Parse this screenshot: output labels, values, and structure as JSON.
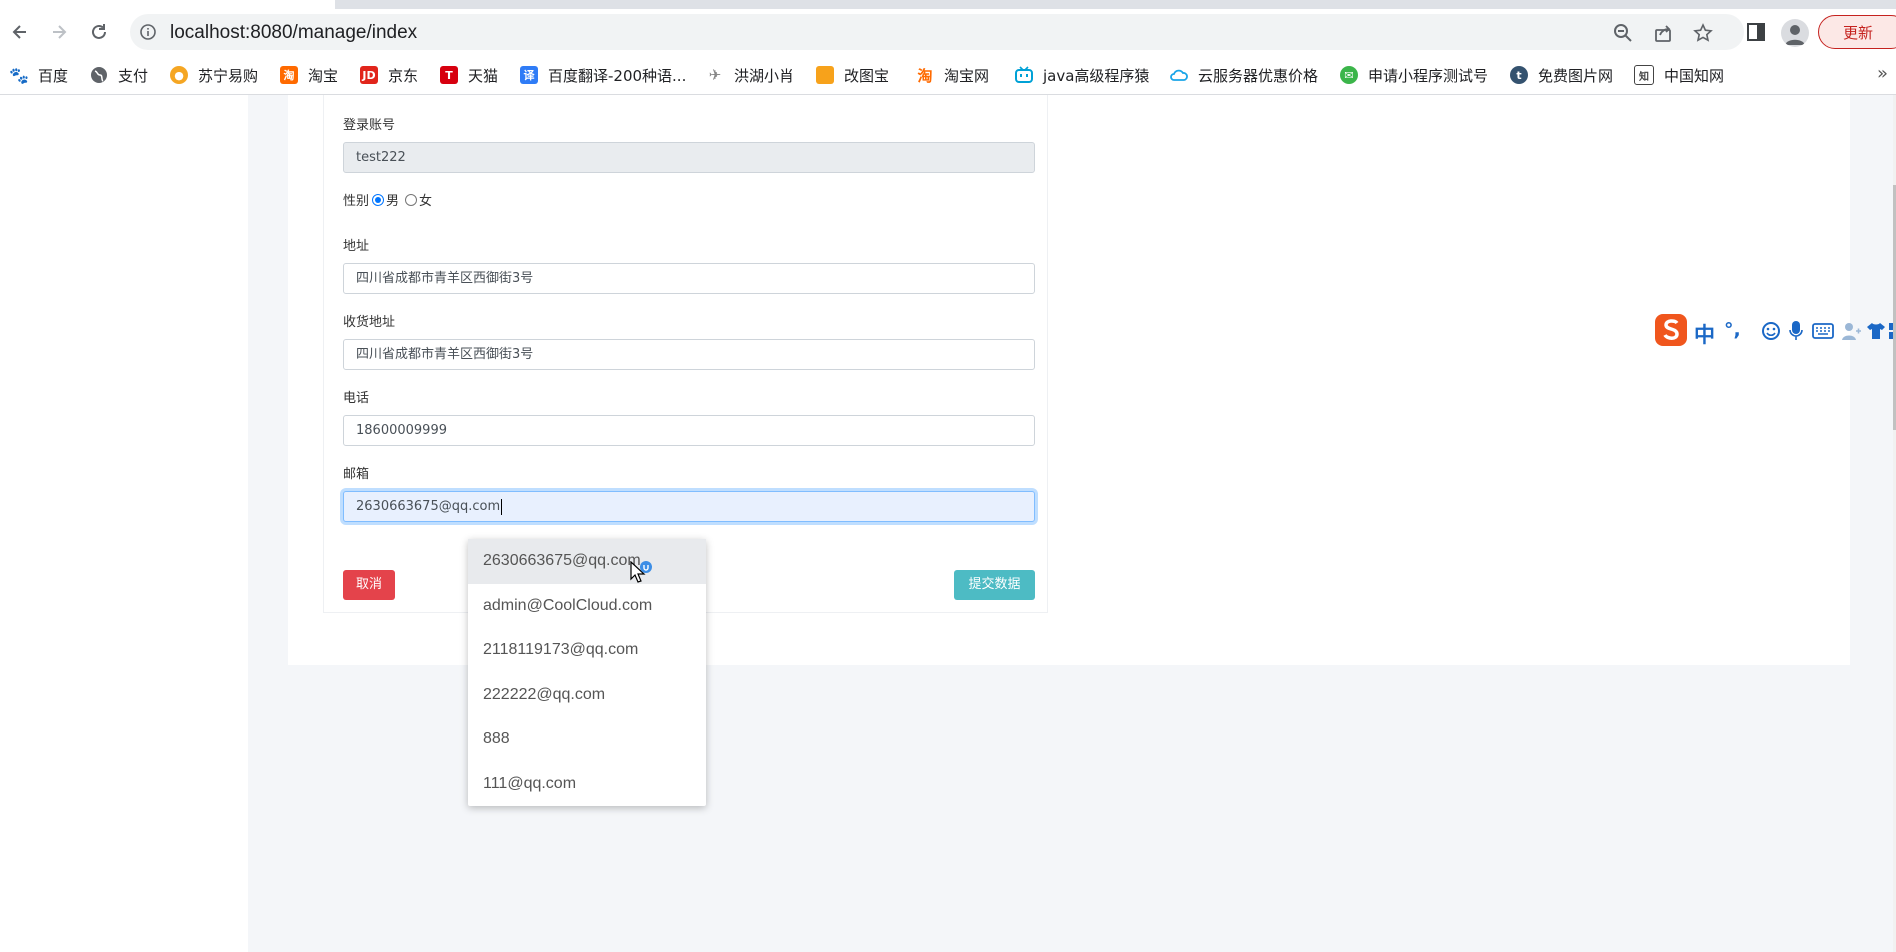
{
  "browser": {
    "url": "localhost:8080/manage/index",
    "update_label": "更新",
    "bookmarks": [
      {
        "label": "百度",
        "icon": "baidu-paw-icon",
        "color": "#2932e1"
      },
      {
        "label": "支付",
        "icon": "globe-icon",
        "color": "#5f6368"
      },
      {
        "label": "苏宁易购",
        "icon": "suning-lion-icon",
        "color": "#f5a623"
      },
      {
        "label": "淘宝",
        "icon": "taobao-icon",
        "color": "#ff6a00"
      },
      {
        "label": "京东",
        "icon": "jd-icon",
        "color": "#e1251b"
      },
      {
        "label": "天猫",
        "icon": "tmall-icon",
        "color": "#d7000f"
      },
      {
        "label": "百度翻译-200种语...",
        "icon": "translate-icon",
        "color": "#2f7cf6"
      },
      {
        "label": "洪湖小肖",
        "icon": "rocket-icon",
        "color": "#888888"
      },
      {
        "label": "改图宝",
        "icon": "gaitubao-icon",
        "color": "#f7a21b"
      },
      {
        "label": "淘宝网",
        "icon": "taobao-tao-icon",
        "color": "#ff6a00"
      },
      {
        "label": "java高级程序猿",
        "icon": "bilibili-icon",
        "color": "#00a1d6"
      },
      {
        "label": "云服务器优惠价格",
        "icon": "cloud-icon",
        "color": "#1aa5e8"
      },
      {
        "label": "申请小程序测试号",
        "icon": "wechat-icon",
        "color": "#3bb54a"
      },
      {
        "label": "免费图片网",
        "icon": "tumblr-icon",
        "color": "#34526f"
      },
      {
        "label": "中国知网",
        "icon": "cnki-icon",
        "color": "#444444"
      }
    ],
    "bookmarks_more": "»"
  },
  "form": {
    "account_label": "登录账号",
    "account_value": "test222",
    "gender_label": "性别",
    "gender_male": "男",
    "gender_female": "女",
    "gender_selected": "男",
    "address_label": "地址",
    "address_value": "四川省成都市青羊区西御街3号",
    "shipping_label": "收货地址",
    "shipping_value": "四川省成都市青羊区西御街3号",
    "phone_label": "电话",
    "phone_value": "18600009999",
    "email_label": "邮箱",
    "email_value": "2630663675@qq.com",
    "cancel_label": "取消",
    "submit_label": "提交数据"
  },
  "autocomplete": {
    "items": [
      "2630663675@qq.com",
      "admin@CoolCloud.com",
      "2118119173@qq.com",
      "222222@qq.com",
      "888",
      "111@qq.com"
    ],
    "highlighted_index": 0
  },
  "ime": {
    "mode": "中",
    "punctuation": "°,"
  },
  "colors": {
    "cancel": "#e4434b",
    "submit": "#4dbbc4",
    "focus": "#80bdff"
  }
}
